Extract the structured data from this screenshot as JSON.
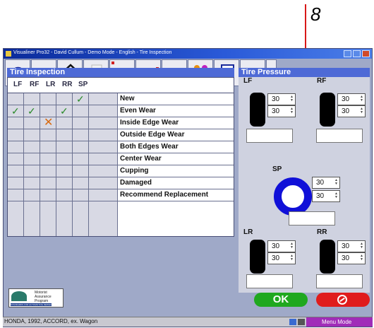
{
  "callout": {
    "label": "8"
  },
  "window": {
    "title": "Visualiner Pro32 - David Cullum - Demo Mode - English - Tire Inspection"
  },
  "toolbar": {
    "buttons": [
      "help-icon",
      "alignment-icon",
      "home-icon",
      "print-icon",
      "blank",
      "blank",
      "blank",
      "tire-icon",
      "clipboard-icon",
      "blank"
    ]
  },
  "inspection": {
    "header": "Tire Inspection",
    "columns": [
      "LF",
      "RF",
      "LR",
      "RR",
      "SP"
    ],
    "rows": [
      {
        "label": "New",
        "marks": [
          "",
          "",
          "",
          "",
          "check"
        ]
      },
      {
        "label": "Even Wear",
        "marks": [
          "check",
          "check",
          "",
          "check",
          ""
        ]
      },
      {
        "label": "Inside Edge Wear",
        "marks": [
          "",
          "",
          "x",
          "",
          ""
        ]
      },
      {
        "label": "Outside Edge Wear",
        "marks": [
          "",
          "",
          "",
          "",
          ""
        ]
      },
      {
        "label": "Both Edges Wear",
        "marks": [
          "",
          "",
          "",
          "",
          ""
        ]
      },
      {
        "label": "Center Wear",
        "marks": [
          "",
          "",
          "",
          "",
          ""
        ]
      },
      {
        "label": "Cupping",
        "marks": [
          "",
          "",
          "",
          "",
          ""
        ]
      },
      {
        "label": "Damaged",
        "marks": [
          "",
          "",
          "",
          "",
          ""
        ]
      },
      {
        "label": "Recommend Replacement",
        "marks": [
          "",
          "",
          "",
          "",
          ""
        ]
      }
    ]
  },
  "pressure": {
    "header": "Tire Pressure",
    "lf": {
      "label": "LF",
      "v1": "30",
      "v2": "30"
    },
    "rf": {
      "label": "RF",
      "v1": "30",
      "v2": "30"
    },
    "sp": {
      "label": "SP",
      "v1": "30",
      "v2": "30"
    },
    "lr": {
      "label": "LR",
      "v1": "30",
      "v2": "30"
    },
    "rr": {
      "label": "RR",
      "v1": "30",
      "v2": "30"
    }
  },
  "logo": {
    "line1": "Motorist",
    "line2": "Assurance",
    "line3": "Program",
    "tagline": "STANDARDS FOR AUTOMOTIVE REPAIR"
  },
  "buttons": {
    "ok": "OK"
  },
  "status": {
    "vehicle": "HONDA, 1992, ACCORD, ex. Wagon",
    "mode": "Menu Mode"
  },
  "colors": {
    "accent": "#4e6ad6",
    "ok": "#1fa81f",
    "cancel": "#e01c1c",
    "check": "#2a8a2a",
    "xmark": "#d86a10"
  }
}
